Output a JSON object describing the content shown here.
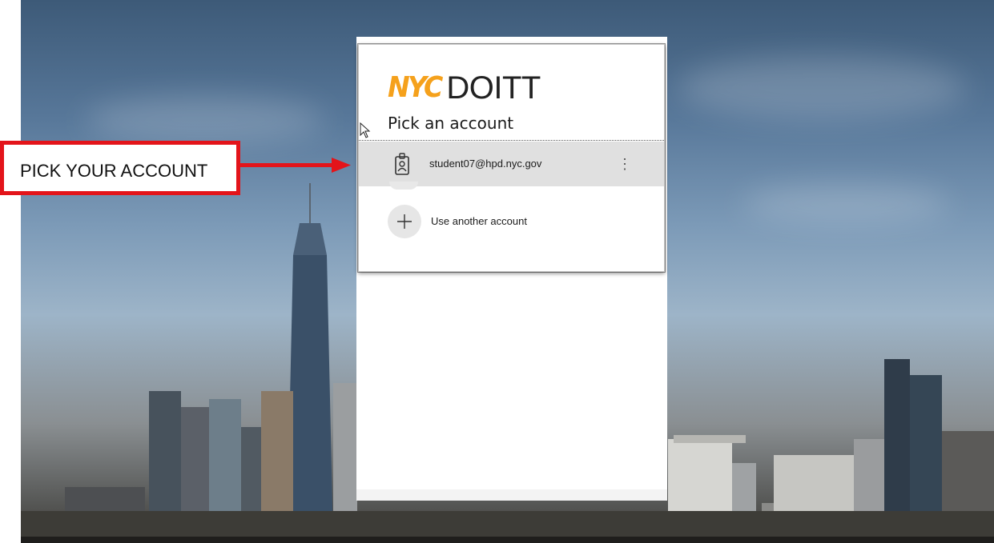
{
  "logo": {
    "nyc": "NYC",
    "doitt": "DOITT"
  },
  "dialog": {
    "heading": "Pick an account",
    "account": {
      "email": "student07@hpd.nyc.gov",
      "more_icon": "more-vertical-icon",
      "badge_icon": "id-badge-icon"
    },
    "add_account": {
      "label": "Use another account",
      "icon": "plus-icon"
    }
  },
  "annotation": {
    "label": "PICK YOUR ACCOUNT",
    "color": "#e3141a"
  },
  "colors": {
    "brand_orange": "#f5a11c",
    "selected_row": "#e0e0e0"
  }
}
